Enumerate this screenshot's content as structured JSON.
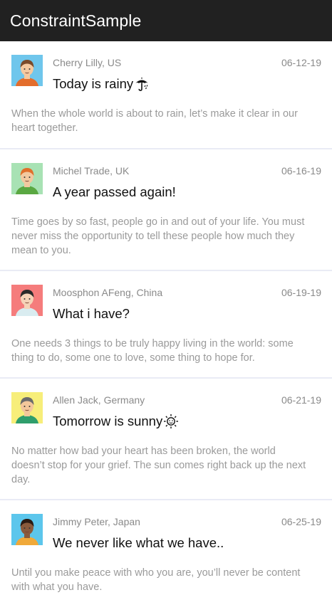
{
  "app": {
    "title": "ConstraintSample"
  },
  "posts": [
    {
      "author": "Cherry Lilly, US",
      "date": "06-12-19",
      "title": "Today is rainy",
      "emoji": "umbrella-icon",
      "body": "When the whole world is about to rain, let’s make it clear in our heart together.",
      "avatar": {
        "bg": "#6fc6ec",
        "skin": "#f5c9a0",
        "hair": "#7a4a2a",
        "shirt": "#e36d2c"
      }
    },
    {
      "author": "Michel Trade, UK",
      "date": "06-16-19",
      "title": "A year passed again!",
      "body": "Time goes by so fast, people go in and out of your life. You must never miss the opportunity to tell these people how much they mean to you.",
      "avatar": {
        "bg": "#a8e2b4",
        "skin": "#f2c9a0",
        "hair": "#e0702c",
        "shirt": "#5aa842"
      }
    },
    {
      "author": "Moosphon AFeng, China",
      "date": "06-19-19",
      "title": "What i have?",
      "body": "One needs 3 things to be truly happy living in the world: some thing to do, some one to love, some thing to hope for.",
      "avatar": {
        "bg": "#f57c7c",
        "skin": "#f5d3b8",
        "hair": "#2a2a2a",
        "shirt": "#d9ecf0"
      }
    },
    {
      "author": "Allen Jack, Germany",
      "date": "06-21-19",
      "title": "Tomorrow is sunny",
      "emoji": "sun-icon",
      "body": "No matter how bad your heart has been broken, the world doesn’t stop for your grief. The sun comes right back up the next day.",
      "avatar": {
        "bg": "#f7ee7a",
        "skin": "#f3c79b",
        "hair": "#6b6b6b",
        "shirt": "#2f9e6c"
      }
    },
    {
      "author": "Jimmy Peter, Japan",
      "date": "06-25-19",
      "title": "We never like what we have..",
      "body": "Until you make peace with who you are, you’ll never be content with what you have.",
      "avatar": {
        "bg": "#5cc6ec",
        "skin": "#8a5a3c",
        "hair": "#2b1a12",
        "shirt": "#f0a93a"
      }
    }
  ]
}
